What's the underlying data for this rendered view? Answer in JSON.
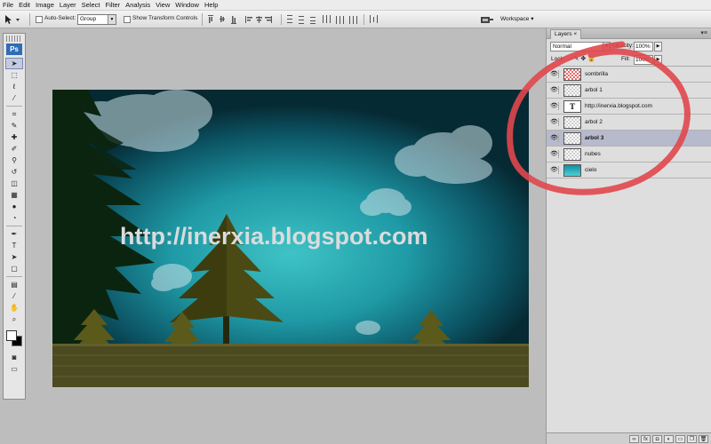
{
  "menu": [
    "File",
    "Edit",
    "Image",
    "Layer",
    "Select",
    "Filter",
    "Analysis",
    "View",
    "Window",
    "Help"
  ],
  "options": {
    "auto_select_label": "Auto-Select:",
    "auto_select_value": "Group",
    "show_transform_label": "Show Transform Controls",
    "workspace_label": "Workspace ▾"
  },
  "tools": {
    "logo": "Ps",
    "items": [
      "move-tool",
      "marquee-tool",
      "lasso-tool",
      "magic-wand-tool",
      "crop-tool",
      "eyedropper-tool",
      "healing-brush-tool",
      "brush-tool",
      "clone-stamp-tool",
      "history-brush-tool",
      "eraser-tool",
      "gradient-tool",
      "blur-tool",
      "dodge-tool",
      "pen-tool",
      "type-tool",
      "path-selection-tool",
      "shape-tool",
      "notes-tool",
      "eyedropper2-tool",
      "hand-tool",
      "zoom-tool"
    ]
  },
  "canvas": {
    "text": "http://inerxia.blogspot.com"
  },
  "layers_panel": {
    "tab_label": "Layers",
    "tab_close": "×",
    "blend_mode": "Normal",
    "opacity_label": "Opacity:",
    "opacity_value": "100%",
    "lock_label": "Lock:",
    "fill_label": "Fill:",
    "fill_value": "100%",
    "layers": [
      {
        "name": "sombrilla",
        "thumb": "red",
        "selected": false
      },
      {
        "name": "arbol 1",
        "thumb": "checker",
        "selected": false
      },
      {
        "name": "http://inerxia.blogspot.com",
        "thumb": "text",
        "selected": false
      },
      {
        "name": "arbol 2",
        "thumb": "checker",
        "selected": false
      },
      {
        "name": "arbol 3",
        "thumb": "checker",
        "selected": true
      },
      {
        "name": "nubes",
        "thumb": "checker",
        "selected": false
      },
      {
        "name": "cielo",
        "thumb": "sky",
        "selected": false
      }
    ]
  },
  "colors": {
    "annotation": "#e0474c",
    "selected_layer": "#b7bacd",
    "ps_logo": "#2f6db5"
  }
}
